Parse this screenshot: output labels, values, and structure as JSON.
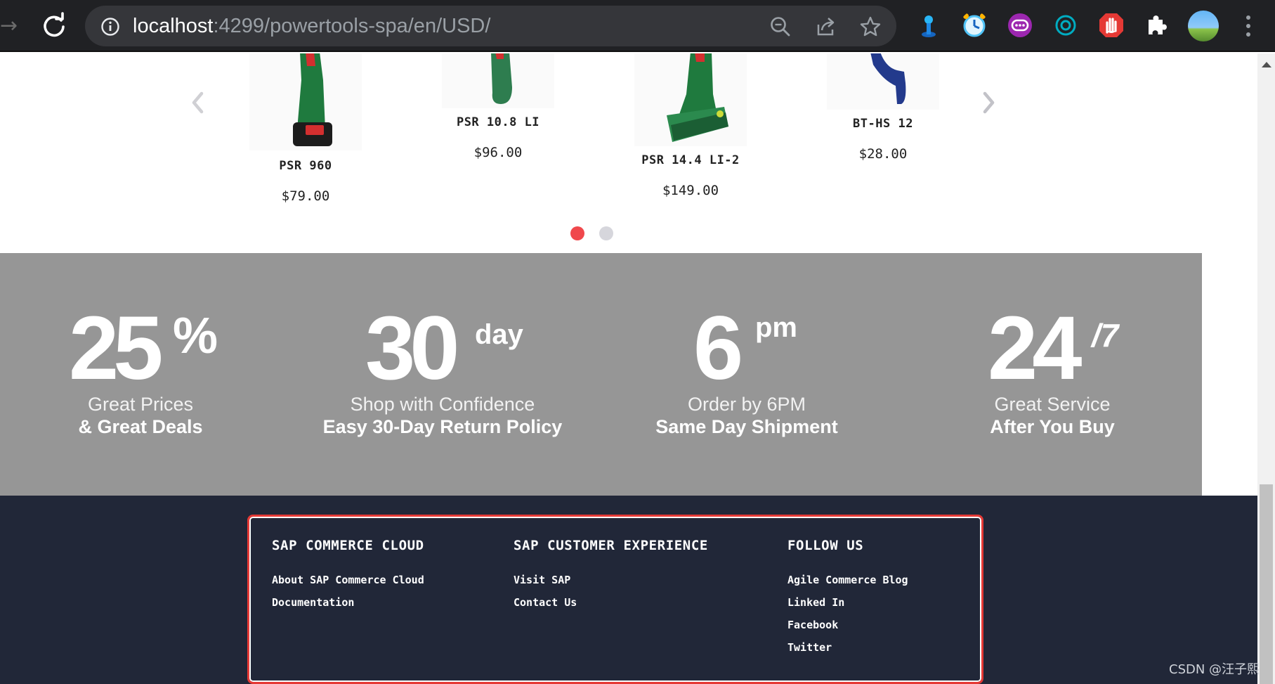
{
  "browser": {
    "url_host": "localhost",
    "url_path": ":4299/powertools-spa/en/USD/",
    "extensions": [
      {
        "name": "ext-blue-figure-icon",
        "color": "#1e88e5"
      },
      {
        "name": "ext-alarm-clock-icon",
        "color": "#4fc3f7"
      },
      {
        "name": "ext-purple-bubble-icon",
        "color": "#9c27b0"
      },
      {
        "name": "ext-teal-target-icon",
        "color": "#00acc1"
      },
      {
        "name": "ext-red-hand-icon",
        "color": "#e53935"
      }
    ]
  },
  "carousel": {
    "products": [
      {
        "name": "PSR 960",
        "price": "$79.00"
      },
      {
        "name": "PSR 10.8 LI",
        "price": "$96.00"
      },
      {
        "name": "PSR 14.4 LI-2",
        "price": "$149.00"
      },
      {
        "name": "BT-HS 12",
        "price": "$28.00"
      }
    ],
    "active_dot_color": "#f0484c",
    "inactive_dot_color": "#d6d6dc"
  },
  "stats": [
    {
      "big": "25",
      "sup": "%",
      "line1": "Great Prices",
      "line2": "& Great Deals"
    },
    {
      "big": "30",
      "sup": "day",
      "line1": "Shop with Confidence",
      "line2": "Easy 30-Day Return Policy"
    },
    {
      "big": "6",
      "sup": "pm",
      "line1": "Order by 6PM",
      "line2": "Same Day Shipment"
    },
    {
      "big": "24",
      "sup": "/7",
      "line1": "Great Service",
      "line2": "After You Buy"
    }
  ],
  "footer": {
    "columns": [
      {
        "title": "SAP COMMERCE CLOUD",
        "links": [
          "About SAP Commerce Cloud",
          "Documentation"
        ]
      },
      {
        "title": "SAP CUSTOMER EXPERIENCE",
        "links": [
          "Visit SAP",
          "Contact Us"
        ]
      },
      {
        "title": "FOLLOW US",
        "links": [
          "Agile Commerce Blog",
          "Linked In",
          "Facebook",
          "Twitter"
        ]
      }
    ]
  },
  "watermark": "CSDN @汪子熙"
}
